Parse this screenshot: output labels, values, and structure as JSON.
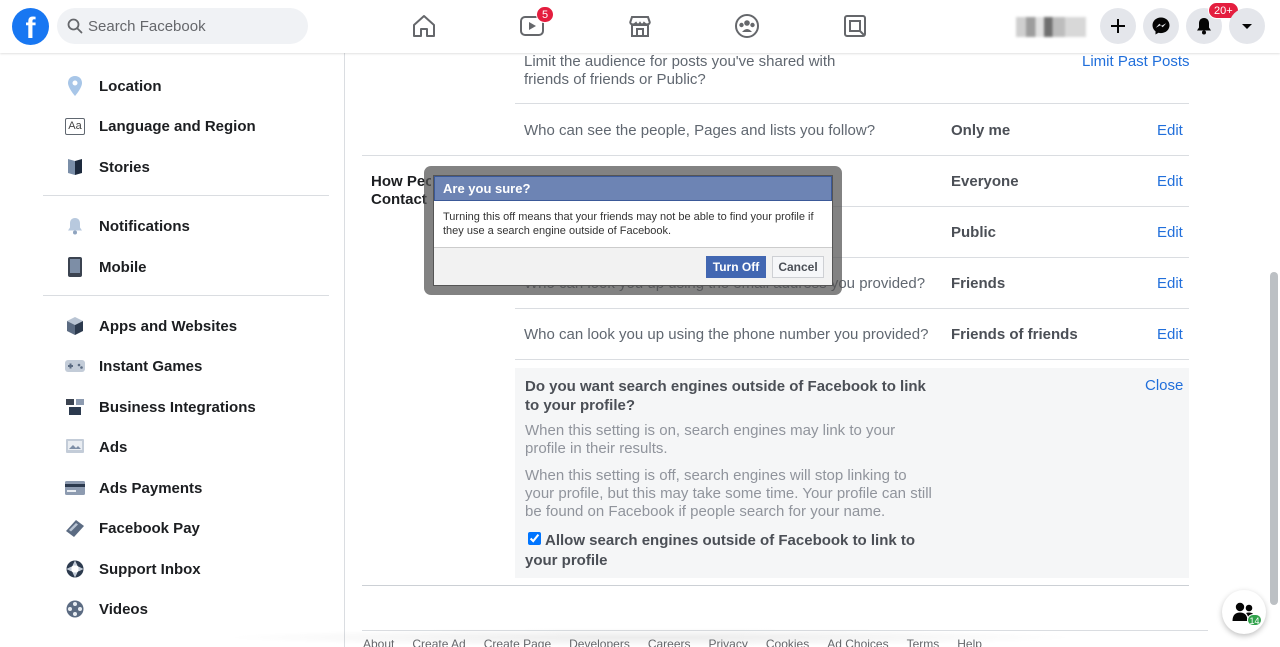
{
  "header": {
    "logo_letter": "f",
    "search_placeholder": "Search Facebook",
    "watch_badge": "5",
    "notifications_badge": "20+"
  },
  "sidebar": {
    "items": [
      {
        "label": "Location",
        "icon": "location-pin-icon"
      },
      {
        "label": "Language and Region",
        "icon": "language-icon"
      },
      {
        "label": "Stories",
        "icon": "stories-book-icon"
      },
      {
        "label": "Notifications",
        "icon": "bell-icon"
      },
      {
        "label": "Mobile",
        "icon": "mobile-phone-icon"
      },
      {
        "label": "Apps and Websites",
        "icon": "cube-icon"
      },
      {
        "label": "Instant Games",
        "icon": "game-controller-icon"
      },
      {
        "label": "Business Integrations",
        "icon": "business-integrations-icon"
      },
      {
        "label": "Ads",
        "icon": "ads-icon"
      },
      {
        "label": "Ads Payments",
        "icon": "credit-card-icon"
      },
      {
        "label": "Facebook Pay",
        "icon": "facebook-pay-icon"
      },
      {
        "label": "Support Inbox",
        "icon": "lifebuoy-icon"
      },
      {
        "label": "Videos",
        "icon": "film-reel-icon"
      }
    ],
    "language_icon_text": "Aa"
  },
  "privacy": {
    "limit_posts_text": "Limit the audience for posts you've shared with friends of friends or Public?",
    "limit_posts_link": "Limit Past Posts",
    "follow_text": "Who can see the people, Pages and lists you follow?",
    "follow_value": "Only me",
    "section_label": "How People Find and Contact You",
    "section_label_line1": "How Peop",
    "section_label_line2": "Contact Y",
    "friend_requests_value": "Everyone",
    "friends_list_value": "Public",
    "email_text": "Who can look you up using the email address you provided?",
    "email_value": "Friends",
    "phone_text": "Who can look you up using the phone number you provided?",
    "phone_value": "Friends of friends",
    "edit_label": "Edit",
    "search_engine": {
      "title": "Do you want search engines outside of Facebook to link to your profile?",
      "close_label": "Close",
      "para_on": "When this setting is on, search engines may link to your profile in their results.",
      "para_off": "When this setting is off, search engines will stop linking to your profile, but this may take some time. Your profile can still be found on Facebook if people search for your name.",
      "checkbox_label": "Allow search engines outside of Facebook to link to your profile",
      "checked": true
    }
  },
  "footer": {
    "links": [
      "About",
      "Create Ad",
      "Create Page",
      "Developers",
      "Careers",
      "Privacy",
      "Cookies",
      "Ad Choices",
      "Terms",
      "Help"
    ]
  },
  "chat": {
    "online_count": "14"
  },
  "modal": {
    "title": "Are you sure?",
    "body": "Turning this off means that your friends may not be able to find your profile if they use a search engine outside of Facebook.",
    "confirm_label": "Turn Off",
    "cancel_label": "Cancel"
  }
}
